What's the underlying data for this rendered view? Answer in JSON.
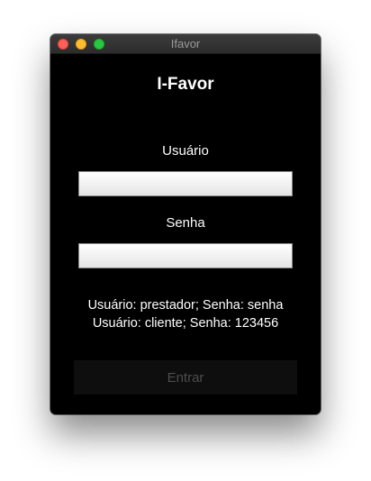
{
  "window": {
    "title": "Ifavor"
  },
  "app": {
    "title": "I-Favor"
  },
  "form": {
    "username_label": "Usuário",
    "username_value": "",
    "password_label": "Senha",
    "password_value": "",
    "submit_label": "Entrar"
  },
  "hints": [
    "Usuário: prestador; Senha: senha",
    "Usuário: cliente; Senha: 123456"
  ],
  "colors": {
    "window_background": "#000000",
    "close": "#ff5f57",
    "minimize": "#febc2e",
    "zoom": "#28c840"
  }
}
